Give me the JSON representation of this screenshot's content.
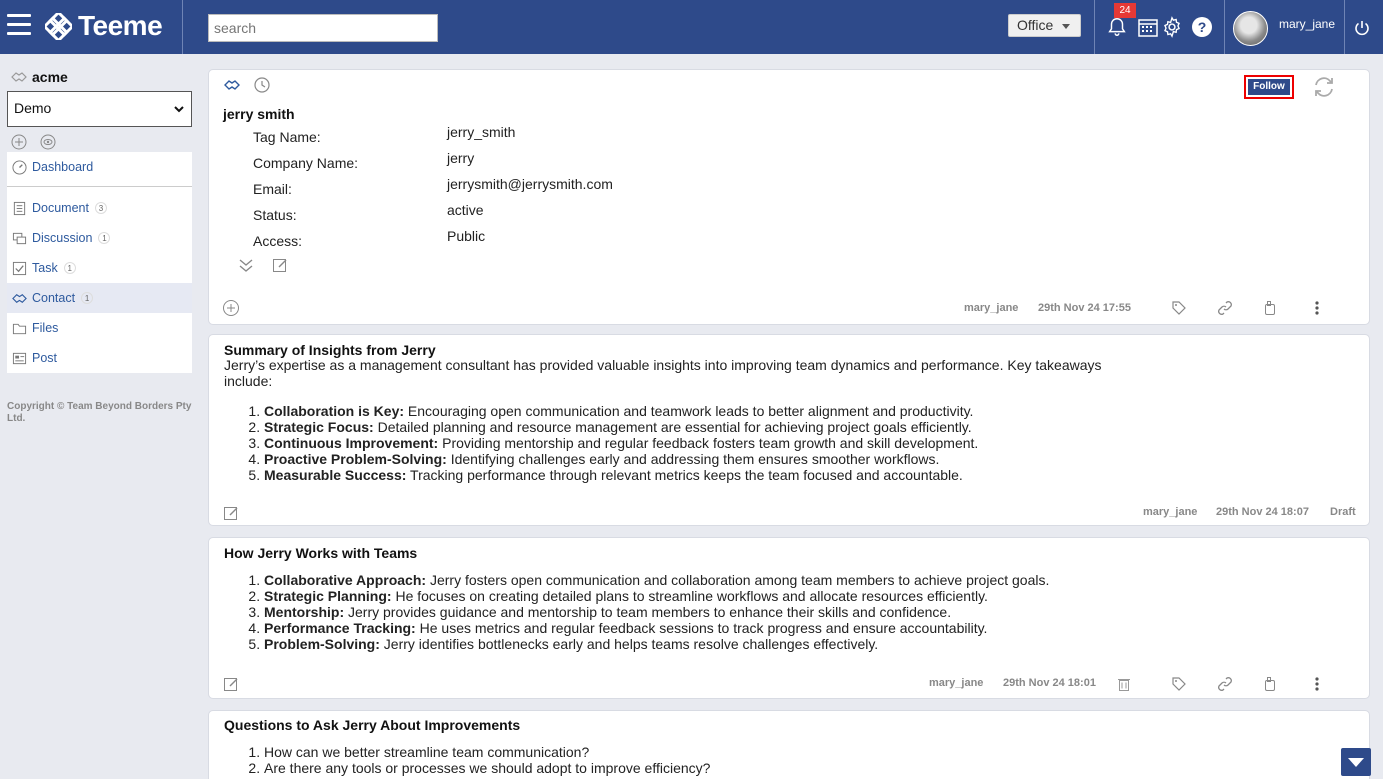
{
  "app": {
    "brand": "Teeme"
  },
  "header": {
    "search_placeholder": "search",
    "office_select": "Office",
    "notifications_count": "24",
    "username": "mary_jane",
    "help_label": "?",
    "icons": [
      "menu-icon",
      "teeme-logo-icon",
      "bell-icon",
      "calendar-icon",
      "gear-icon",
      "help-icon",
      "power-icon"
    ]
  },
  "sidebar": {
    "org_name": "acme",
    "workspace_select": "Demo",
    "items": [
      {
        "label": "Dashboard",
        "icon": "dashboard-icon",
        "count": ""
      },
      {
        "label": "Document",
        "icon": "document-icon",
        "count": "3"
      },
      {
        "label": "Discussion",
        "icon": "discussion-icon",
        "count": "1"
      },
      {
        "label": "Task",
        "icon": "task-icon",
        "count": "1"
      },
      {
        "label": "Contact",
        "icon": "contact-icon",
        "count": "1"
      },
      {
        "label": "Files",
        "icon": "folder-icon",
        "count": ""
      },
      {
        "label": "Post",
        "icon": "post-icon",
        "count": ""
      }
    ],
    "copyright": "Copyright © Team Beyond Borders Pty Ltd."
  },
  "contact": {
    "name": "jerry smith",
    "follow_label": "Follow",
    "fields": [
      {
        "label": "Tag Name:",
        "value": "jerry_smith"
      },
      {
        "label": "Company Name:",
        "value": "jerry"
      },
      {
        "label": "Email:",
        "value": "jerrysmith@jerrysmith.com"
      },
      {
        "label": "Status:",
        "value": "active"
      },
      {
        "label": "Access:",
        "value": "Public"
      }
    ],
    "author": "mary_jane",
    "timestamp": "29th Nov 24 17:55"
  },
  "posts": [
    {
      "title": "Summary of Insights from Jerry",
      "intro": "Jerry’s expertise as a management consultant has provided valuable insights into improving team dynamics and performance. Key takeaways include:",
      "items": [
        {
          "bold": "Collaboration is Key:",
          "text": " Encouraging open communication and teamwork leads to better alignment and productivity."
        },
        {
          "bold": "Strategic Focus:",
          "text": " Detailed planning and resource management are essential for achieving project goals efficiently."
        },
        {
          "bold": "Continuous Improvement:",
          "text": " Providing mentorship and regular feedback fosters team growth and skill development."
        },
        {
          "bold": "Proactive Problem-Solving:",
          "text": " Identifying challenges early and addressing them ensures smoother workflows."
        },
        {
          "bold": "Measurable Success:",
          "text": " Tracking performance through relevant metrics keeps the team focused and accountable."
        }
      ],
      "author": "mary_jane",
      "timestamp": "29th Nov 24 18:07",
      "status": "Draft"
    },
    {
      "title": "How Jerry Works with Teams",
      "items": [
        {
          "bold": "Collaborative Approach:",
          "text": " Jerry fosters open communication and collaboration among team members to achieve project goals."
        },
        {
          "bold": "Strategic Planning:",
          "text": " He focuses on creating detailed plans to streamline workflows and allocate resources efficiently."
        },
        {
          "bold": "Mentorship:",
          "text": " Jerry provides guidance and mentorship to team members to enhance their skills and confidence."
        },
        {
          "bold": "Performance Tracking:",
          "text": " He uses metrics and regular feedback sessions to track progress and ensure accountability."
        },
        {
          "bold": "Problem-Solving:",
          "text": " Jerry identifies bottlenecks early and helps teams resolve challenges effectively."
        }
      ],
      "author": "mary_jane",
      "timestamp": "29th Nov 24 18:01"
    },
    {
      "title": "Questions to Ask Jerry About Improvements",
      "items": [
        {
          "bold": "",
          "text": "How can we better streamline team communication?"
        },
        {
          "bold": "",
          "text": "Are there any tools or processes we should adopt to improve efficiency?"
        }
      ]
    }
  ]
}
